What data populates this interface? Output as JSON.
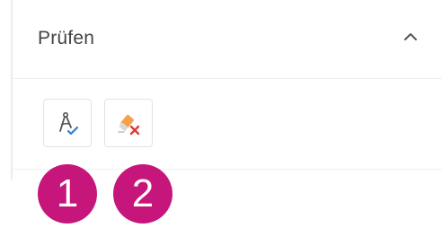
{
  "panel": {
    "title": "Prüfen",
    "collapse_icon": "chevron-up-icon"
  },
  "toolbar": {
    "buttons": [
      {
        "icon": "compass-check-icon",
        "accent": "#2f7fd1"
      },
      {
        "icon": "eraser-x-icon",
        "accent": "#f28c2b",
        "mark": "#e53935"
      }
    ]
  },
  "badges": [
    {
      "label": "1",
      "color": "#c6167c"
    },
    {
      "label": "2",
      "color": "#c6167c"
    }
  ]
}
